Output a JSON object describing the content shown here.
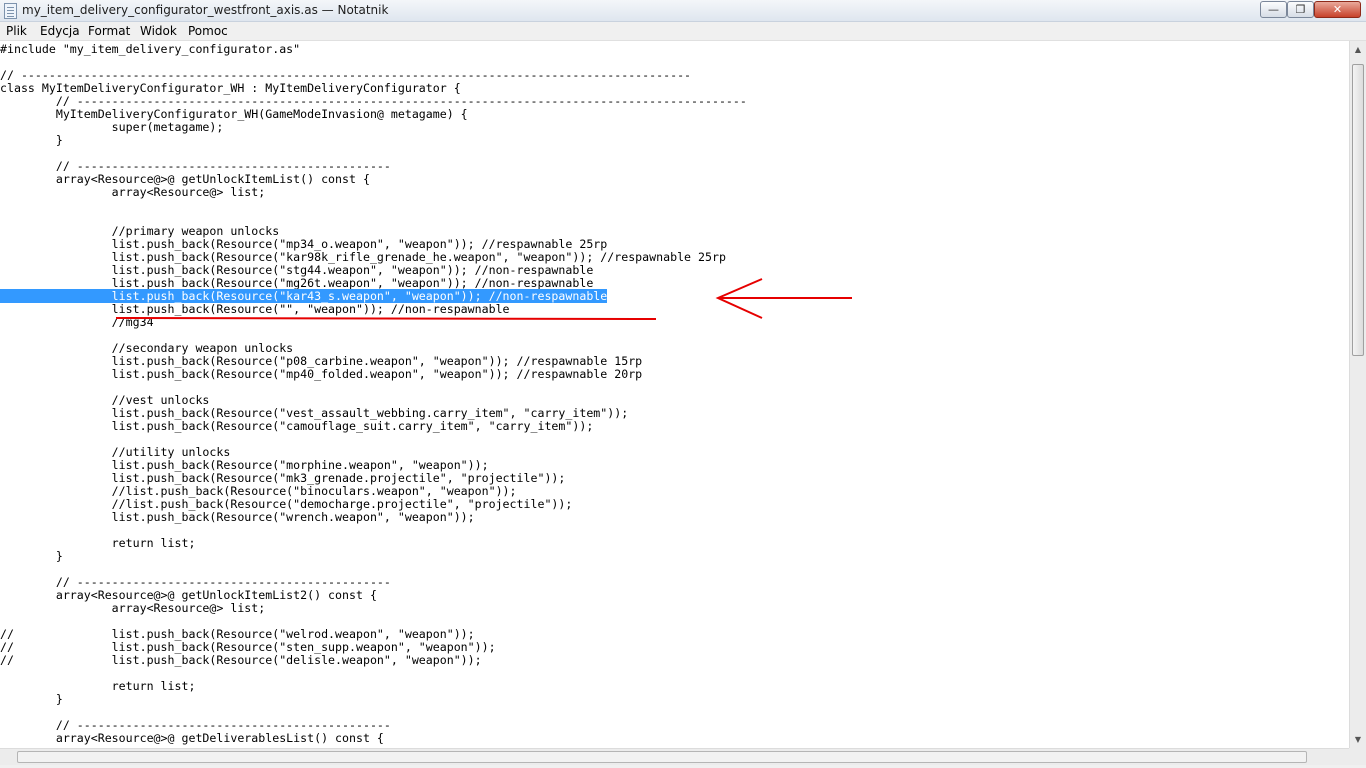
{
  "window": {
    "title": "my_item_delivery_configurator_westfront_axis.as — Notatnik",
    "minimize": "—",
    "maximize": "❐",
    "close": "✕"
  },
  "menu": [
    "Plik",
    "Edycja",
    "Format",
    "Widok",
    "Pomoc"
  ],
  "colors": {
    "selection": "#3399ff",
    "annotation": "#e60000"
  },
  "icons": {
    "app": "notepad-icon",
    "scroll_up": "arrow-up-icon",
    "scroll_down": "arrow-down-icon"
  },
  "editor": {
    "selected_line_index": 19,
    "annotation_arrow_line": 19,
    "annotation_underline_line": 20,
    "lines": [
      "#include \"my_item_delivery_configurator.as\"",
      "",
      "// ------------------------------------------------------------------------------------------------",
      "class MyItemDeliveryConfigurator_WH : MyItemDeliveryConfigurator {",
      "        // ------------------------------------------------------------------------------------------------",
      "        MyItemDeliveryConfigurator_WH(GameModeInvasion@ metagame) {",
      "                super(metagame);",
      "        }",
      "",
      "        // ---------------------------------------------",
      "        array<Resource@>@ getUnlockItemList() const {",
      "                array<Resource@> list;",
      "",
      "",
      "                //primary weapon unlocks",
      "                list.push_back(Resource(\"mp34_o.weapon\", \"weapon\")); //respawnable 25rp",
      "                list.push_back(Resource(\"kar98k_rifle_grenade_he.weapon\", \"weapon\")); //respawnable 25rp",
      "                list.push_back(Resource(\"stg44.weapon\", \"weapon\")); //non-respawnable",
      "                list.push_back(Resource(\"mg26t.weapon\", \"weapon\")); //non-respawnable",
      "                list.push_back(Resource(\"kar43_s.weapon\", \"weapon\")); //non-respawnable",
      "                list.push_back(Resource(\"\", \"weapon\")); //non-respawnable",
      "                //mg34",
      "",
      "                //secondary weapon unlocks",
      "                list.push_back(Resource(\"p08_carbine.weapon\", \"weapon\")); //respawnable 15rp",
      "                list.push_back(Resource(\"mp40_folded.weapon\", \"weapon\")); //respawnable 20rp",
      "",
      "                //vest unlocks",
      "                list.push_back(Resource(\"vest_assault_webbing.carry_item\", \"carry_item\"));",
      "                list.push_back(Resource(\"camouflage_suit.carry_item\", \"carry_item\"));",
      "",
      "                //utility unlocks",
      "                list.push_back(Resource(\"morphine.weapon\", \"weapon\"));",
      "                list.push_back(Resource(\"mk3_grenade.projectile\", \"projectile\"));",
      "                //list.push_back(Resource(\"binoculars.weapon\", \"weapon\"));",
      "                //list.push_back(Resource(\"democharge.projectile\", \"projectile\"));",
      "                list.push_back(Resource(\"wrench.weapon\", \"weapon\"));",
      "",
      "                return list;",
      "        }",
      "",
      "        // ---------------------------------------------",
      "        array<Resource@>@ getUnlockItemList2() const {",
      "                array<Resource@> list;",
      "",
      "//              list.push_back(Resource(\"welrod.weapon\", \"weapon\"));",
      "//              list.push_back(Resource(\"sten_supp.weapon\", \"weapon\"));",
      "//              list.push_back(Resource(\"delisle.weapon\", \"weapon\"));",
      "",
      "                return list;",
      "        }",
      "",
      "        // ---------------------------------------------",
      "        array<Resource@>@ getDeliverablesList() const {"
    ]
  }
}
